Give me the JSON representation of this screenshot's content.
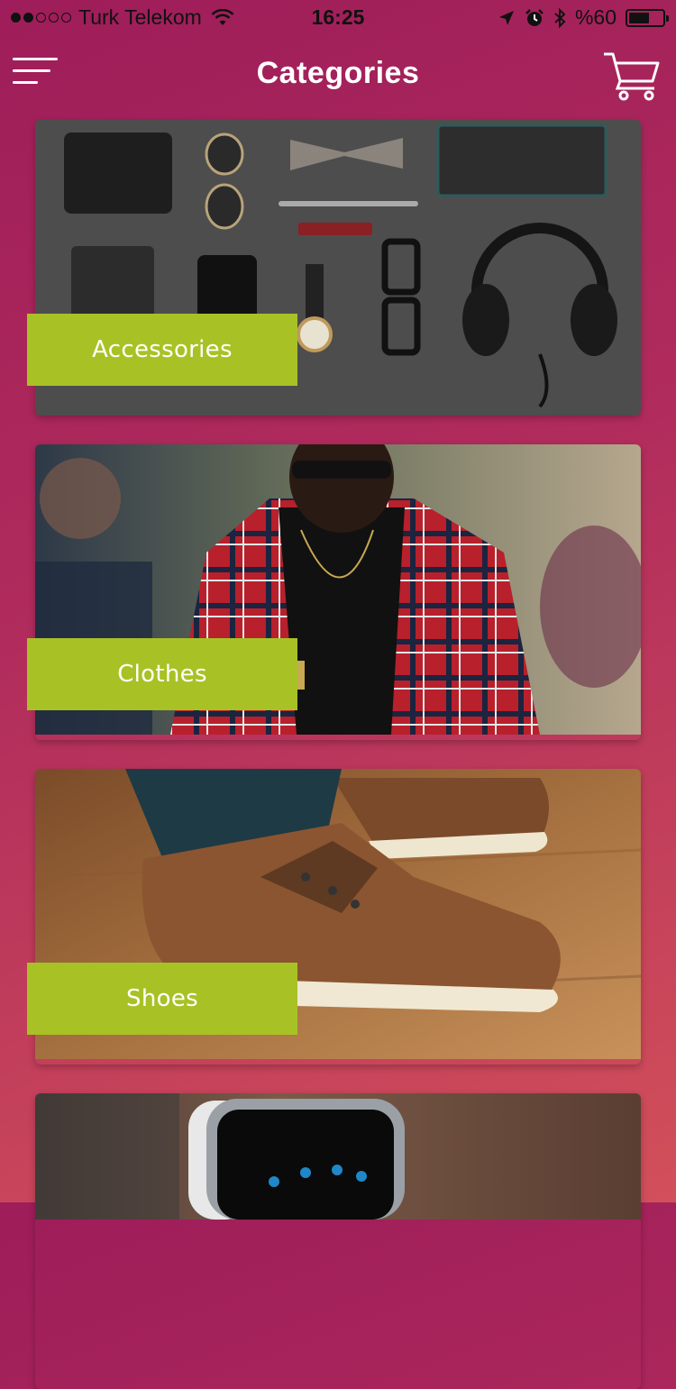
{
  "status_bar": {
    "carrier": "Turk Telekom",
    "time": "16:25",
    "battery_text": "%60",
    "battery_level": 0.6,
    "signal_bars_filled": 2,
    "signal_bars_total": 5
  },
  "navbar": {
    "title": "Categories",
    "menu_icon": "hamburger-menu-icon",
    "cart_icon": "shopping-cart-icon"
  },
  "categories": [
    {
      "label": "Accessories"
    },
    {
      "label": "Clothes"
    },
    {
      "label": "Shoes"
    },
    {
      "label": ""
    }
  ],
  "colors": {
    "accent_green": "#a8c225",
    "background_top": "#9e1d5a",
    "background_bottom": "#d2505a"
  }
}
